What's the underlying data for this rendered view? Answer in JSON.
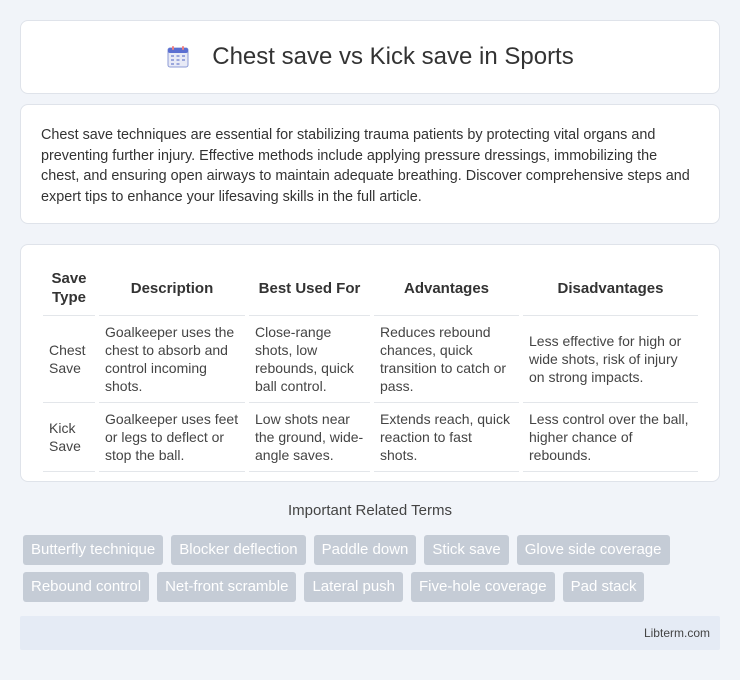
{
  "header": {
    "title": "Chest save vs Kick save in Sports",
    "icon": "calendar-icon"
  },
  "intro": {
    "text": "Chest save techniques are essential for stabilizing trauma patients by protecting vital organs and preventing further injury. Effective methods include applying pressure dressings, immobilizing the chest, and ensuring open airways to maintain adequate breathing. Discover comprehensive steps and expert tips to enhance your lifesaving skills in the full article."
  },
  "table": {
    "headers": [
      "Save Type",
      "Description",
      "Best Used For",
      "Advantages",
      "Disadvantages"
    ],
    "rows": [
      [
        "Chest Save",
        "Goalkeeper uses the chest to absorb and control incoming shots.",
        "Close-range shots, low rebounds, quick ball control.",
        "Reduces rebound chances, quick transition to catch or pass.",
        "Less effective for high or wide shots, risk of injury on strong impacts."
      ],
      [
        "Kick Save",
        "Goalkeeper uses feet or legs to deflect or stop the ball.",
        "Low shots near the ground, wide-angle saves.",
        "Extends reach, quick reaction to fast shots.",
        "Less control over the ball, higher chance of rebounds."
      ]
    ]
  },
  "related": {
    "title": "Important Related Terms",
    "row1": [
      "Butterfly technique",
      "Blocker deflection",
      "Paddle down",
      "Stick save",
      "Glove side coverage"
    ],
    "row2": [
      "Rebound control",
      "Net-front scramble",
      "Lateral push",
      "Five-hole coverage",
      "Pad stack"
    ]
  },
  "footer": {
    "text": "Libterm.com"
  },
  "colors": {
    "background": "#f1f4f9",
    "tag_bg": "#c5ccd6",
    "footer_bg": "#e5ebf5"
  }
}
